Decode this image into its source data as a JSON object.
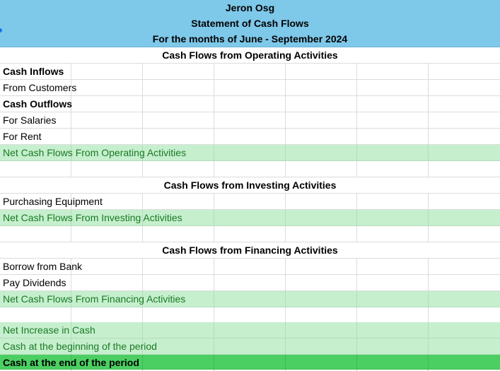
{
  "header": {
    "company": "Jeron Osg",
    "statement": "Statement of Cash Flows",
    "period": "For the months of June - September 2024"
  },
  "operating": {
    "title": "Cash Flows from Operating Activities",
    "inflows_label": "Cash Inflows",
    "from_customers": "From Customers",
    "outflows_label": "Cash Outflows",
    "for_salaries": "For Salaries",
    "for_rent": "For Rent",
    "net_label": "Net Cash Flows From Operating Activities"
  },
  "investing": {
    "title": "Cash Flows from Investing Activities",
    "purchasing_equipment": "Purchasing Equipment",
    "net_label": "Net Cash Flows From Investing Activities"
  },
  "financing": {
    "title": "Cash Flows from Financing Activities",
    "borrow_from_bank": "Borrow from Bank",
    "pay_dividends": "Pay Dividends",
    "net_label": "Net Cash Flows From Financing Activities"
  },
  "summary": {
    "net_increase": "Net Increase in Cash",
    "cash_beginning": "Cash at the beginning of the period",
    "cash_end": "Cash at the end of the period"
  },
  "colors": {
    "header_band": "#7ec8e9",
    "subtotal_band": "#c6efce",
    "total_band": "#4bcf62",
    "subtotal_text": "#1a7a24"
  }
}
